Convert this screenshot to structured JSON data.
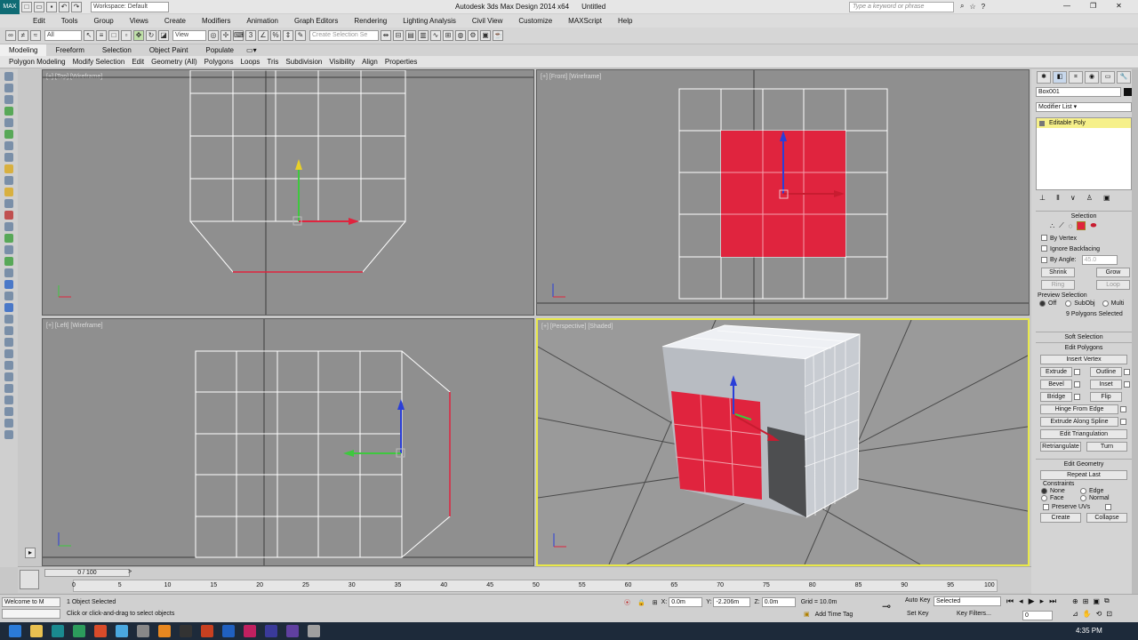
{
  "titlebar": {
    "workspace": "Workspace: Default",
    "title": "Autodesk 3ds Max Design 2014 x64",
    "document": "Untitled",
    "search_placeholder": "Type a keyword or phrase"
  },
  "menu": [
    "Edit",
    "Tools",
    "Group",
    "Views",
    "Create",
    "Modifiers",
    "Animation",
    "Graph Editors",
    "Rendering",
    "Lighting Analysis",
    "Civil View",
    "Customize",
    "MAXScript",
    "Help"
  ],
  "toolbar": {
    "selection_filter": "All",
    "ref_coord": "View",
    "named_selection_placeholder": "Create Selection Se"
  },
  "ribbon": {
    "tabs": [
      "Modeling",
      "Freeform",
      "Selection",
      "Object Paint",
      "Populate"
    ],
    "active_tab": "Modeling",
    "subtabs": [
      "Polygon Modeling",
      "Modify Selection",
      "Edit",
      "Geometry (All)",
      "Polygons",
      "Loops",
      "Tris",
      "Subdivision",
      "Visibility",
      "Align",
      "Properties"
    ]
  },
  "viewports": {
    "top": "[+] [Top] [Wireframe]",
    "front": "[+] [Front] [Wireframe]",
    "left": "[+] [Left] [Wireframe]",
    "perspective": "[+] [Perspective] [Shaded]"
  },
  "command_panel": {
    "object_name": "Box001",
    "modifier_list": "Modifier List",
    "modifier_stack_item": "Editable Poly",
    "selection_rollout": "Selection",
    "by_vertex": "By Vertex",
    "ignore_backfacing": "Ignore Backfacing",
    "by_angle": "By Angle:",
    "by_angle_value": "45.0",
    "shrink": "Shrink",
    "grow": "Grow",
    "ring": "Ring",
    "loop": "Loop",
    "preview_selection": "Preview Selection",
    "preview_off": "Off",
    "preview_subobj": "SubObj",
    "preview_multi": "Multi",
    "selected_count": "9 Polygons Selected",
    "soft_selection": "Soft Selection",
    "edit_polygons": "Edit Polygons",
    "insert_vertex": "Insert Vertex",
    "extrude": "Extrude",
    "outline": "Outline",
    "bevel": "Bevel",
    "inset": "Inset",
    "bridge": "Bridge",
    "flip": "Flip",
    "hinge_from_edge": "Hinge From Edge",
    "extrude_along_spline": "Extrude Along Spline",
    "edit_triangulation": "Edit Triangulation",
    "retriangulate": "Retriangulate",
    "turn": "Turn",
    "edit_geometry": "Edit Geometry",
    "repeat_last": "Repeat Last",
    "constraints": "Constraints",
    "c_none": "None",
    "c_edge": "Edge",
    "c_face": "Face",
    "c_normal": "Normal",
    "preserve_uvs": "Preserve UVs",
    "create": "Create",
    "collapse": "Collapse"
  },
  "timeline": {
    "frame_counter": "0 / 100",
    "ticks": [
      "0",
      "5",
      "10",
      "15",
      "20",
      "25",
      "30",
      "35",
      "40",
      "45",
      "50",
      "55",
      "60",
      "65",
      "70",
      "75",
      "80",
      "85",
      "90",
      "95",
      "100"
    ]
  },
  "status": {
    "maxscript_listener": "Welcome to M",
    "selected": "1 Object Selected",
    "prompt": "Click or click-and-drag to select objects",
    "x_label": "X:",
    "x_value": "0.0m",
    "y_label": "Y:",
    "y_value": "-2.206m",
    "z_label": "Z:",
    "z_value": "0.0m",
    "grid": "Grid = 10.0m",
    "add_time_tag": "Add Time Tag",
    "auto_key": "Auto Key",
    "set_key": "Set Key",
    "key_mode": "Selected",
    "key_filters": "Key Filters...",
    "frame": "0"
  },
  "taskbar": {
    "time": "4:35 PM"
  },
  "colors": {
    "selected_polygon": "#e0243e",
    "wire": "#ffffff",
    "active_viewport_border": "#e8e84a"
  }
}
